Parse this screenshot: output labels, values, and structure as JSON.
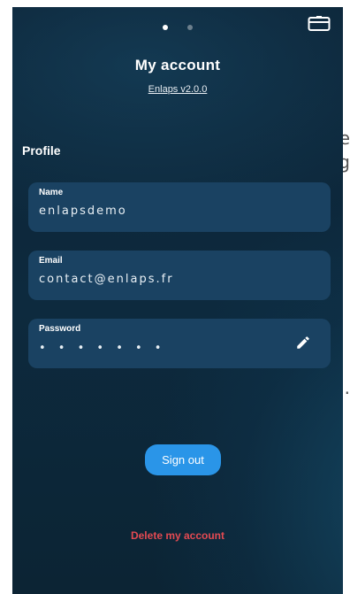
{
  "background_text": {
    "line1": "e",
    "line2": "g",
    "line3": "."
  },
  "pager": {
    "pages": 2,
    "active_index": 0
  },
  "header": {
    "title": "My account",
    "version": "Enlaps v2.0.0"
  },
  "profile": {
    "section_title": "Profile",
    "fields": [
      {
        "label": "Name",
        "value": "enlapsdemo"
      },
      {
        "label": "Email",
        "value": "contact@enlaps.fr"
      },
      {
        "label": "Password",
        "value": "• • • • • • •"
      }
    ]
  },
  "actions": {
    "sign_out": "Sign out",
    "delete_account": "Delete my account"
  },
  "colors": {
    "accent": "#2a95e8",
    "danger": "#e44a52",
    "field_bg": "#1a4262",
    "page_bg": "#0c2234"
  },
  "icons": {
    "top_right": "device-icon",
    "password_action": "edit-pencil-icon"
  }
}
